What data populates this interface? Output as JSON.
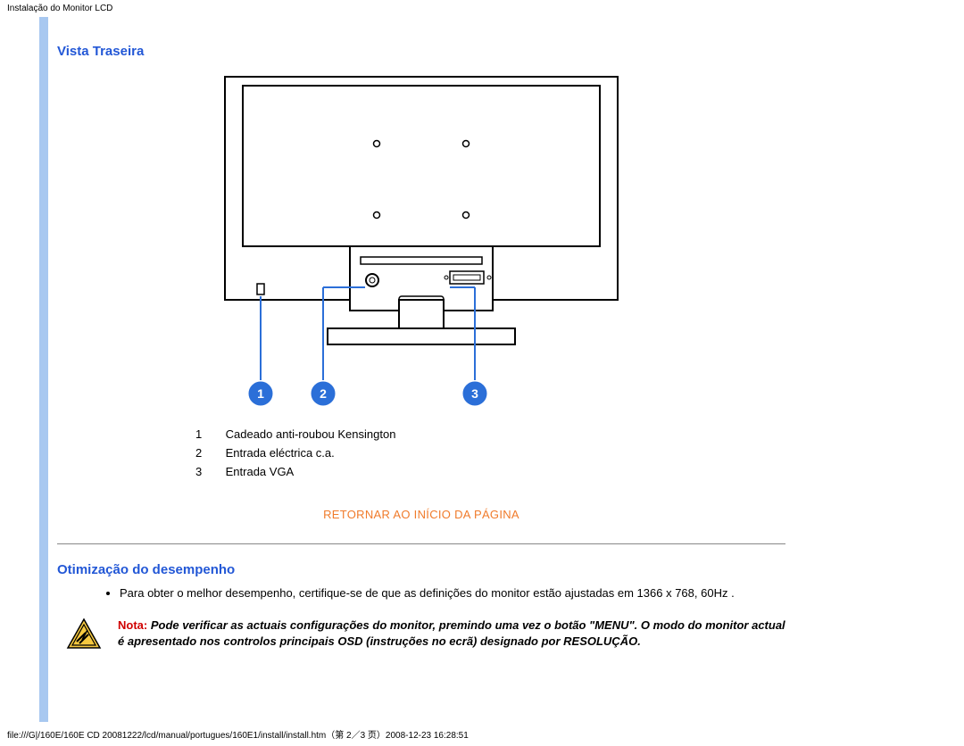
{
  "header": {
    "title": "Instalação do Monitor LCD"
  },
  "section1": {
    "title": "Vista Traseira"
  },
  "callouts": {
    "c1": "1",
    "c2": "2",
    "c3": "3"
  },
  "legend": {
    "r1": {
      "num": "1",
      "label": "Cadeado anti-roubou Kensington"
    },
    "r2": {
      "num": "2",
      "label": "Entrada eléctrica c.a."
    },
    "r3": {
      "num": "3",
      "label": "Entrada VGA"
    }
  },
  "return_link": "RETORNAR AO INÍCIO DA PÁGINA",
  "section2": {
    "title": "Otimização do desempenho"
  },
  "bullet1": "Para obter o melhor desempenho, certifique-se de que as definições do monitor estão ajustadas em 1366 x 768, 60Hz .",
  "note": {
    "label": "Nota:",
    "body": " Pode verificar as actuais configurações do monitor, premindo uma vez o botão \"MENU\". O modo do monitor actual é apresentado nos controlos principais OSD (instruções no ecrã) designado por RESOLUÇÃO."
  },
  "footer": {
    "path": "file:///G|/160E/160E CD 20081222/lcd/manual/portugues/160E1/install/install.htm（第 2／3 页）2008-12-23 16:28:51"
  }
}
